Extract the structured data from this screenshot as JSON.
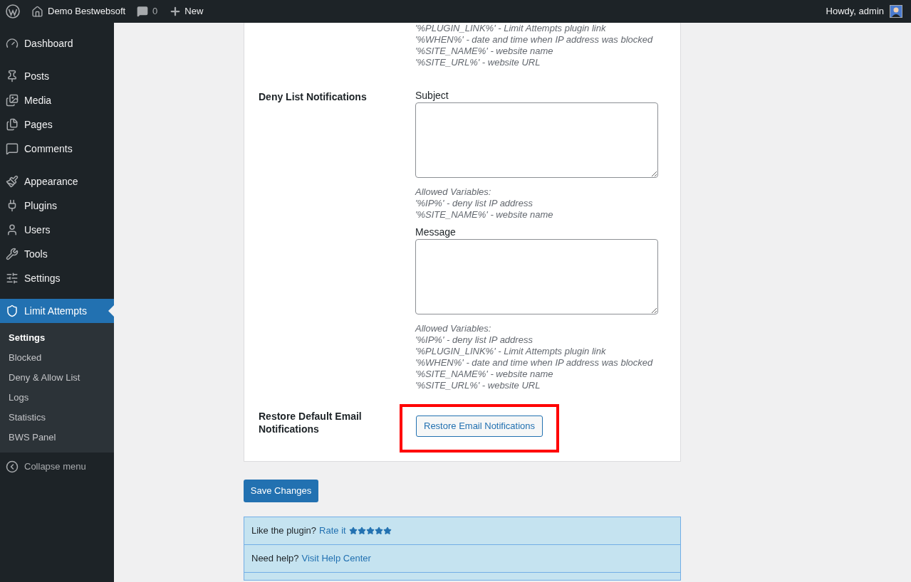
{
  "admin_bar": {
    "site_name": "Demo Bestwebsoft",
    "comments_count": "0",
    "new_label": "New",
    "greeting": "Howdy, admin"
  },
  "sidebar": {
    "groups": [
      {
        "items": [
          {
            "label": "Dashboard",
            "selected": false
          }
        ]
      },
      {
        "items": [
          {
            "label": "Posts",
            "selected": false
          },
          {
            "label": "Media",
            "selected": false
          },
          {
            "label": "Pages",
            "selected": false
          },
          {
            "label": "Comments",
            "selected": false
          }
        ]
      },
      {
        "items": [
          {
            "label": "Appearance",
            "selected": false
          },
          {
            "label": "Plugins",
            "selected": false
          },
          {
            "label": "Users",
            "selected": false
          },
          {
            "label": "Tools",
            "selected": false
          },
          {
            "label": "Settings",
            "selected": false
          }
        ]
      },
      {
        "items": [
          {
            "label": "Limit Attempts",
            "selected": true
          }
        ]
      }
    ],
    "submenu": [
      {
        "label": "Settings",
        "selected": true
      },
      {
        "label": "Blocked",
        "selected": false
      },
      {
        "label": "Deny & Allow List",
        "selected": false
      },
      {
        "label": "Logs",
        "selected": false
      },
      {
        "label": "Statistics",
        "selected": false
      },
      {
        "label": "BWS Panel",
        "selected": false
      }
    ],
    "collapse_label": "Collapse menu"
  },
  "content": {
    "previous_hint_lines": [
      "'%PLUGIN_LINK%' - Limit Attempts plugin link",
      "'%WHEN%' - date and time when IP address was blocked",
      "'%SITE_NAME%' - website name",
      "'%SITE_URL%' - website URL"
    ],
    "deny_list": {
      "label": "Deny List Notifications",
      "fields": [
        {
          "label": "Subject",
          "hint_title": "Allowed Variables:",
          "hint_lines": [
            "'%IP%' - deny list IP address",
            "'%SITE_NAME%' - website name"
          ]
        },
        {
          "label": "Message",
          "hint_title": "Allowed Variables:",
          "hint_lines": [
            "'%IP%' - deny list IP address",
            "'%PLUGIN_LINK%' - Limit Attempts plugin link",
            "'%WHEN%' - date and time when IP address was blocked",
            "'%SITE_NAME%' - website name",
            "'%SITE_URL%' - website URL"
          ]
        }
      ]
    },
    "restore": {
      "label": "Restore Default Email Notifications",
      "button": "Restore Email Notifications",
      "highlighted": true
    },
    "save_button": "Save Changes",
    "info_rows": [
      {
        "text": "Like the plugin?",
        "link": "Rate it",
        "stars": 5
      },
      {
        "text": "Need help?",
        "link": "Visit Help Center"
      }
    ]
  }
}
